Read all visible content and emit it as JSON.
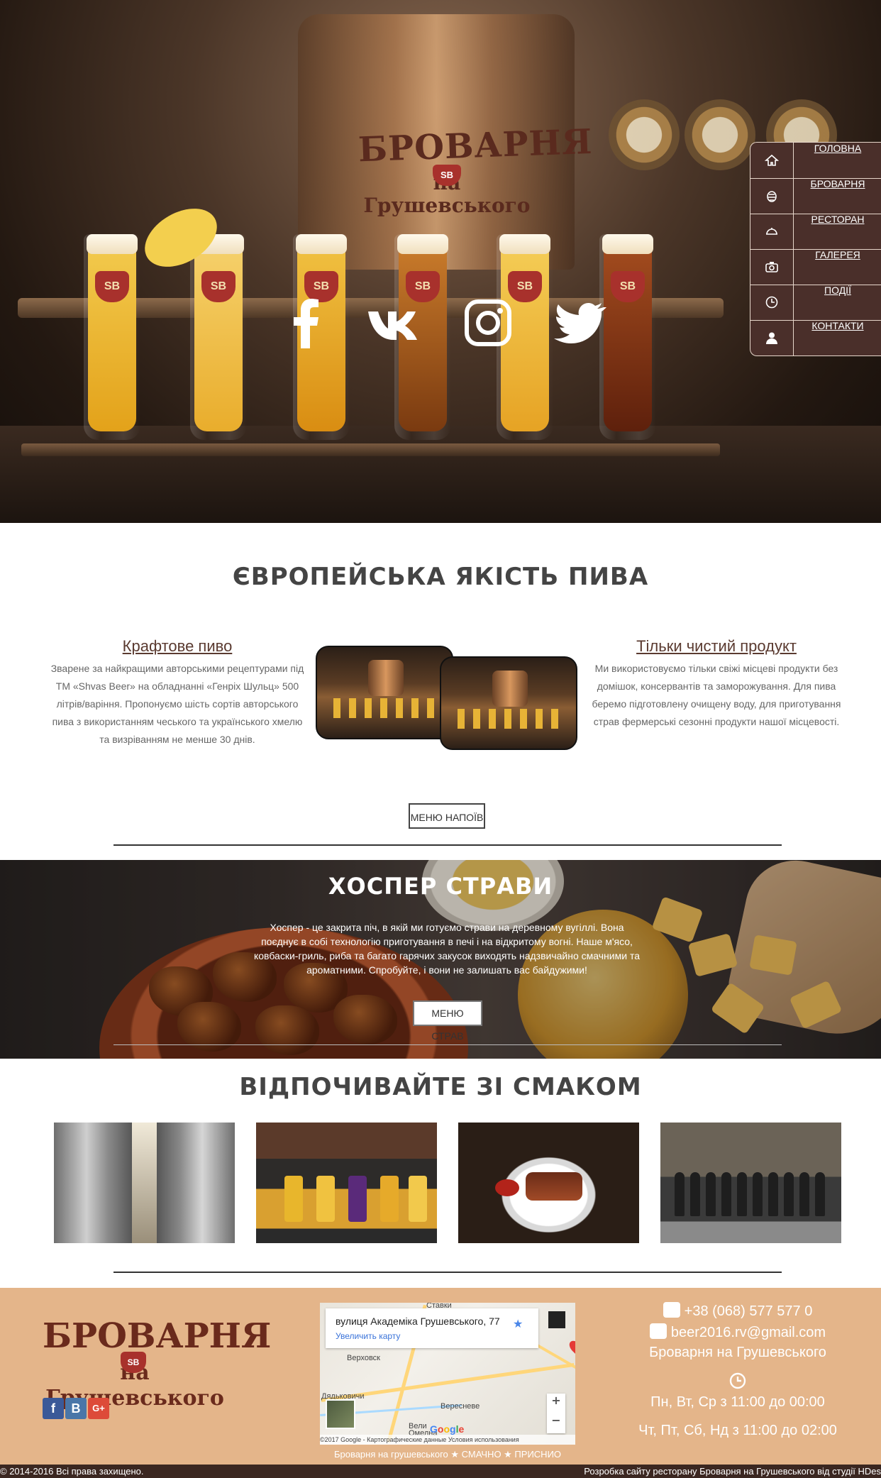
{
  "nav": {
    "items": [
      {
        "label": "ГОЛОВНА",
        "icon": "home-icon"
      },
      {
        "label": "БРОВАРНЯ",
        "icon": "hop-icon"
      },
      {
        "label": "РЕСТОРАН",
        "icon": "dish-icon"
      },
      {
        "label": "ГАЛЕРЕЯ",
        "icon": "camera-icon"
      },
      {
        "label": "ПОДІЇ",
        "icon": "clock-icon"
      },
      {
        "label": "КОНТАКТИ",
        "icon": "user-icon"
      }
    ]
  },
  "hero": {
    "logo_line1": "БРОВАРНЯ",
    "logo_line2": "на Грушевського",
    "logo_badge": "SB",
    "glass_badge": "SB",
    "social": [
      "facebook",
      "vk",
      "instagram",
      "twitter"
    ]
  },
  "quality": {
    "title": "ЄВРОПЕЙСЬКА ЯКІСТЬ ПИВА",
    "left_title": "Крафтове пиво",
    "left_text": "Зварене за найкращими авторськими рецептурами під ТМ «Shvas Beer» на обладнанні «Генріх Шульц» 500 літрів/варіння. Пропонуємо шість сортів авторського пива з використанням чеського та українського хмелю та визріванням не менше 30 днів.",
    "right_title": "Тільки чистий продукт",
    "right_text": "Ми використовуємо тільки свіжі місцеві продукти без домішок, консервантів та заморожування. Для пива беремо підготовлену очищену воду, для приготування страв фермерські сезонні продукти нашої місцевості.",
    "button": "МЕНЮ НАПОЇВ"
  },
  "hosper": {
    "title": "ХОСПЕР СТРАВИ",
    "text": "Хоспер - це закрита піч, в якій ми готуємо страви на деревному вугіллі. Вона поєднує в собі технологію приготування в печі і на відкритому вогні. Наше м'ясо, ковбаски-гриль, риба та багато гарячих закусок виходять надзвичайно смачними та ароматними. Спробуйте, і вони не залишать вас байдужими!",
    "button": "МЕНЮ СТРАВ"
  },
  "relax": {
    "title": "ВІДПОЧИВАЙТЕ ЗІ СМАКОМ"
  },
  "footer": {
    "logo_line1": "БРОВАРНЯ",
    "logo_line2": "на Грушевського",
    "logo_badge": "SB",
    "social": [
      "f",
      "B",
      "G+"
    ],
    "map": {
      "address": "вулиця Академіка Грушевського, 77",
      "enlarge": "Увеличить карту",
      "labels": [
        "Ставки",
        "Верховск",
        "Дядьковичи",
        "Вересневе",
        "Вели",
        "Омелна"
      ],
      "zoom_in": "+",
      "zoom_out": "−",
      "brand": "Google",
      "legal": "©2017 Google - Картографические данные   Условия использования"
    },
    "phone": "+38 (068) 577 577 0",
    "email": "beer2016.rv@gmail.com",
    "name": "Броварня на Грушевського",
    "hours1": "Пн, Вт, Ср з 11:00 до 00:00",
    "hours2": "Чт, Пт, Сб, Нд з 11:00 до 02:00",
    "tagline": "Броварня на грушевського ★ СМАЧНО ★ ПРИСНИО"
  },
  "bottom": {
    "copyright": "© 2014-2016 Всі права захищено.",
    "credit": "Розробка сайту ресторану Броварня на Грушевського від студії HDes"
  },
  "colors": {
    "nav_bg": "#4a2f2a",
    "footer_bg": "#e4b58a",
    "bottom_bar": "#3b2721",
    "badge_red": "#a8312c"
  }
}
